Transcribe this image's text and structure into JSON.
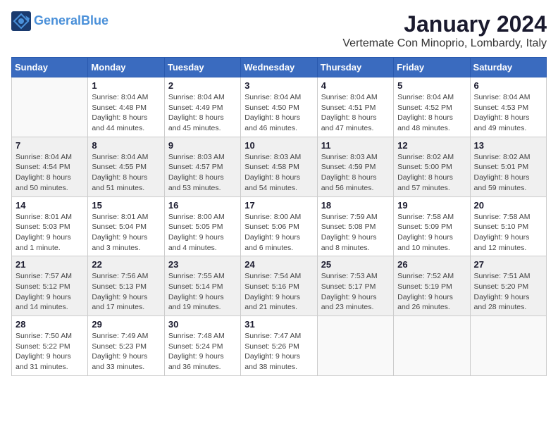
{
  "header": {
    "logo_line1": "General",
    "logo_line2": "Blue",
    "month_year": "January 2024",
    "location": "Vertemate Con Minoprio, Lombardy, Italy"
  },
  "weekdays": [
    "Sunday",
    "Monday",
    "Tuesday",
    "Wednesday",
    "Thursday",
    "Friday",
    "Saturday"
  ],
  "weeks": [
    [
      {
        "day": "",
        "info": ""
      },
      {
        "day": "1",
        "info": "Sunrise: 8:04 AM\nSunset: 4:48 PM\nDaylight: 8 hours\nand 44 minutes."
      },
      {
        "day": "2",
        "info": "Sunrise: 8:04 AM\nSunset: 4:49 PM\nDaylight: 8 hours\nand 45 minutes."
      },
      {
        "day": "3",
        "info": "Sunrise: 8:04 AM\nSunset: 4:50 PM\nDaylight: 8 hours\nand 46 minutes."
      },
      {
        "day": "4",
        "info": "Sunrise: 8:04 AM\nSunset: 4:51 PM\nDaylight: 8 hours\nand 47 minutes."
      },
      {
        "day": "5",
        "info": "Sunrise: 8:04 AM\nSunset: 4:52 PM\nDaylight: 8 hours\nand 48 minutes."
      },
      {
        "day": "6",
        "info": "Sunrise: 8:04 AM\nSunset: 4:53 PM\nDaylight: 8 hours\nand 49 minutes."
      }
    ],
    [
      {
        "day": "7",
        "info": "Sunrise: 8:04 AM\nSunset: 4:54 PM\nDaylight: 8 hours\nand 50 minutes."
      },
      {
        "day": "8",
        "info": "Sunrise: 8:04 AM\nSunset: 4:55 PM\nDaylight: 8 hours\nand 51 minutes."
      },
      {
        "day": "9",
        "info": "Sunrise: 8:03 AM\nSunset: 4:57 PM\nDaylight: 8 hours\nand 53 minutes."
      },
      {
        "day": "10",
        "info": "Sunrise: 8:03 AM\nSunset: 4:58 PM\nDaylight: 8 hours\nand 54 minutes."
      },
      {
        "day": "11",
        "info": "Sunrise: 8:03 AM\nSunset: 4:59 PM\nDaylight: 8 hours\nand 56 minutes."
      },
      {
        "day": "12",
        "info": "Sunrise: 8:02 AM\nSunset: 5:00 PM\nDaylight: 8 hours\nand 57 minutes."
      },
      {
        "day": "13",
        "info": "Sunrise: 8:02 AM\nSunset: 5:01 PM\nDaylight: 8 hours\nand 59 minutes."
      }
    ],
    [
      {
        "day": "14",
        "info": "Sunrise: 8:01 AM\nSunset: 5:03 PM\nDaylight: 9 hours\nand 1 minute."
      },
      {
        "day": "15",
        "info": "Sunrise: 8:01 AM\nSunset: 5:04 PM\nDaylight: 9 hours\nand 3 minutes."
      },
      {
        "day": "16",
        "info": "Sunrise: 8:00 AM\nSunset: 5:05 PM\nDaylight: 9 hours\nand 4 minutes."
      },
      {
        "day": "17",
        "info": "Sunrise: 8:00 AM\nSunset: 5:06 PM\nDaylight: 9 hours\nand 6 minutes."
      },
      {
        "day": "18",
        "info": "Sunrise: 7:59 AM\nSunset: 5:08 PM\nDaylight: 9 hours\nand 8 minutes."
      },
      {
        "day": "19",
        "info": "Sunrise: 7:58 AM\nSunset: 5:09 PM\nDaylight: 9 hours\nand 10 minutes."
      },
      {
        "day": "20",
        "info": "Sunrise: 7:58 AM\nSunset: 5:10 PM\nDaylight: 9 hours\nand 12 minutes."
      }
    ],
    [
      {
        "day": "21",
        "info": "Sunrise: 7:57 AM\nSunset: 5:12 PM\nDaylight: 9 hours\nand 14 minutes."
      },
      {
        "day": "22",
        "info": "Sunrise: 7:56 AM\nSunset: 5:13 PM\nDaylight: 9 hours\nand 17 minutes."
      },
      {
        "day": "23",
        "info": "Sunrise: 7:55 AM\nSunset: 5:14 PM\nDaylight: 9 hours\nand 19 minutes."
      },
      {
        "day": "24",
        "info": "Sunrise: 7:54 AM\nSunset: 5:16 PM\nDaylight: 9 hours\nand 21 minutes."
      },
      {
        "day": "25",
        "info": "Sunrise: 7:53 AM\nSunset: 5:17 PM\nDaylight: 9 hours\nand 23 minutes."
      },
      {
        "day": "26",
        "info": "Sunrise: 7:52 AM\nSunset: 5:19 PM\nDaylight: 9 hours\nand 26 minutes."
      },
      {
        "day": "27",
        "info": "Sunrise: 7:51 AM\nSunset: 5:20 PM\nDaylight: 9 hours\nand 28 minutes."
      }
    ],
    [
      {
        "day": "28",
        "info": "Sunrise: 7:50 AM\nSunset: 5:22 PM\nDaylight: 9 hours\nand 31 minutes."
      },
      {
        "day": "29",
        "info": "Sunrise: 7:49 AM\nSunset: 5:23 PM\nDaylight: 9 hours\nand 33 minutes."
      },
      {
        "day": "30",
        "info": "Sunrise: 7:48 AM\nSunset: 5:24 PM\nDaylight: 9 hours\nand 36 minutes."
      },
      {
        "day": "31",
        "info": "Sunrise: 7:47 AM\nSunset: 5:26 PM\nDaylight: 9 hours\nand 38 minutes."
      },
      {
        "day": "",
        "info": ""
      },
      {
        "day": "",
        "info": ""
      },
      {
        "day": "",
        "info": ""
      }
    ]
  ]
}
